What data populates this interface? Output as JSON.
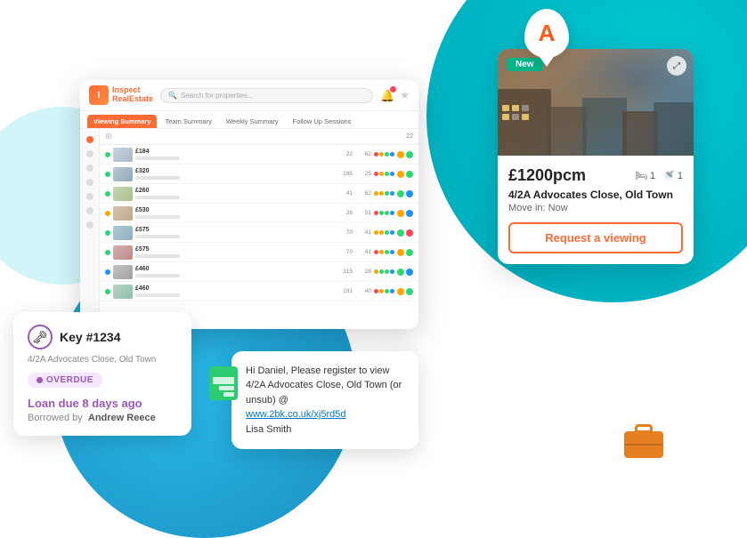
{
  "background": {
    "teal_circle": true,
    "blue_circle": true
  },
  "app_window": {
    "logo": {
      "name": "Inspect",
      "name2": "RealEstate"
    },
    "search_placeholder": "Search for properties...",
    "tabs": [
      {
        "label": "Viewing Summary",
        "active": true
      },
      {
        "label": "Team Summary",
        "active": false
      },
      {
        "label": "Weekly Summary",
        "active": false
      },
      {
        "label": "Follow Up Sessions",
        "active": false
      }
    ],
    "col_count": "22",
    "rows": [
      {
        "price": "£184",
        "n1": "22",
        "n2": "62",
        "colors": [
          "#ff4757",
          "#ffa502",
          "#2ed573",
          "#1e90ff"
        ],
        "status": "green"
      },
      {
        "price": "£320",
        "n1": "195",
        "n2": "25",
        "colors": [
          "#ff4757",
          "#ffa502",
          "#2ed573",
          "#1e90ff"
        ],
        "status": "green"
      },
      {
        "price": "£260",
        "n1": "41",
        "n2": "62",
        "colors": [
          "#ffa502",
          "#ffa502",
          "#2ed573",
          "#1e90ff"
        ],
        "status": "green"
      },
      {
        "price": "£530",
        "n1": "26",
        "n2": "51",
        "colors": [
          "#ff4757",
          "#2ed573",
          "#2ed573",
          "#1e90ff"
        ],
        "status": "orange"
      },
      {
        "price": "£575",
        "n1": "70",
        "n2": "41",
        "colors": [
          "#ffa502",
          "#ffa502",
          "#2ed573",
          "#1e90ff"
        ],
        "status": "green"
      },
      {
        "price": "£575",
        "n1": "70",
        "n2": "41",
        "colors": [
          "#ff4757",
          "#ffa502",
          "#2ed573",
          "#1e90ff"
        ],
        "status": "green"
      },
      {
        "price": "£460",
        "n1": "315",
        "n2": "28",
        "colors": [
          "#ffa502",
          "#2ed573",
          "#2ed573",
          "#1e90ff"
        ],
        "status": "blue"
      },
      {
        "price": "£460",
        "n1": "191",
        "n2": "40",
        "colors": [
          "#ff4757",
          "#ffa502",
          "#2ed573",
          "#1e90ff"
        ],
        "status": "green"
      }
    ]
  },
  "property_card": {
    "badge": "New",
    "price": "£1200pcm",
    "beds": "1",
    "baths": "1",
    "address": "4/2A Advocates Close, Old Town",
    "movein_label": "Move in:",
    "movein_value": "Now",
    "cta_label": "Request a viewing"
  },
  "key_card": {
    "key_id": "Key #1234",
    "address": "4/2A Advocates Close, Old Town",
    "status": "OVERDUE",
    "loan_due": "Loan due 8 days ago",
    "borrowed_by_label": "Borrowed by",
    "borrowed_by_name": "Andrew Reece"
  },
  "sms_card": {
    "message": "Hi Daniel, Please register to view 4/2A Advocates Close, Old Town (or unsub) @",
    "link": "www.2bk.co.uk/xj5rd5d",
    "sender": "Lisa Smith"
  },
  "a_logo": {
    "letter": "A"
  }
}
